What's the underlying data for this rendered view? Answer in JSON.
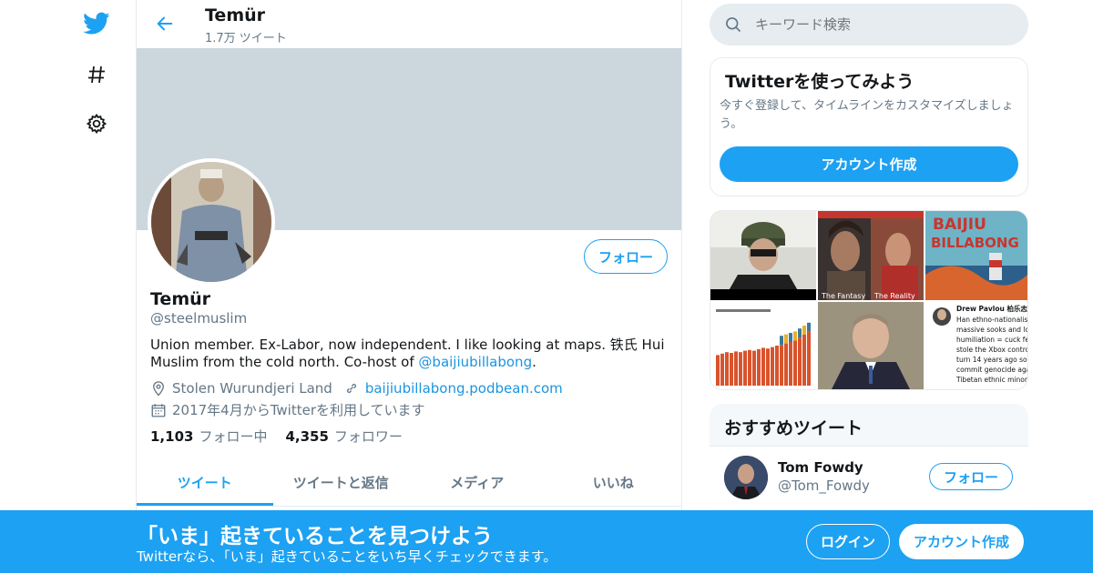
{
  "colors": {
    "brand": "#1da1f2",
    "banner": "#ccd6dd",
    "muted": "#657786",
    "link": "#1b95e0"
  },
  "nav": {
    "icons": [
      "twitter-bird-icon",
      "hashtag-icon",
      "gear-icon"
    ]
  },
  "header": {
    "title": "Temür",
    "subtitle": "1.7万 ツイート"
  },
  "profile": {
    "follow_label": "フォロー",
    "name": "Temür",
    "handle": "@steelmuslim",
    "bio_text": "Union member. Ex-Labor, now independent. I like looking at maps. 铁氏 Hui Muslim from the cold north. Co-host of ",
    "bio_link": "@baijiubillabong",
    "bio_end": ".",
    "location": "Stolen Wurundjeri Land",
    "website": "baijiubillabong.podbean.com",
    "joined": "2017年4月からTwitterを利用しています",
    "following_count": "1,103",
    "following_label": "フォロー中",
    "followers_count": "4,355",
    "followers_label": "フォロワー"
  },
  "tabs": [
    {
      "label": "ツイート"
    },
    {
      "label": "ツイートと返信"
    },
    {
      "label": "メディア"
    },
    {
      "label": "いいね"
    }
  ],
  "search": {
    "placeholder": "キーワード検索"
  },
  "signup_card": {
    "title": "Twitterを使ってみよう",
    "text": "今すぐ登録して、タイムラインをカスタマイズしましょう。",
    "button": "アカウント作成"
  },
  "media": {
    "texts": {
      "fantasy": "The Fantasy",
      "reality": "The Reality",
      "poster_line1": "BAIJIU",
      "poster_line2": "BILLABONG",
      "tweet_author": "Drew Pavlou 柏乐志 @",
      "tweet_lines": [
        "Han ethno-nationalism",
        "massive sooks and los",
        "humiliation = cuck feti",
        "stole the Xbox control",
        "turn 14 years ago so r",
        "commit genocide agai",
        "Tibetan ethnic minorit"
      ]
    }
  },
  "recommend": {
    "title": "おすすめツイート",
    "name": "Tom Fowdy",
    "handle": "@Tom_Fowdy",
    "follow_label": "フォロー"
  },
  "bottom_bar": {
    "title": "「いま」起きていることを見つけよう",
    "subtitle": "Twitterなら、「いま」起きていることをいち早くチェックできます。",
    "login": "ログイン",
    "signup": "アカウント作成"
  }
}
